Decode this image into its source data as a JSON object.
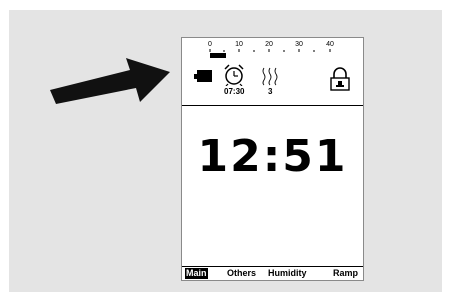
{
  "scale": {
    "labels": [
      "0",
      "10",
      "20",
      "30",
      "40"
    ],
    "level_fraction": 0.13
  },
  "status": {
    "alarm_time": "07:30",
    "humidity_level": "3"
  },
  "clock": {
    "time": "12:51"
  },
  "menu": {
    "items": [
      {
        "label": "Main",
        "active": true
      },
      {
        "label": "Others",
        "active": false
      },
      {
        "label": "Humidity",
        "active": false
      },
      {
        "label": "Ramp",
        "active": false
      }
    ]
  },
  "colors": {
    "background_panel": "#e4e4e4",
    "screen": "#ffffff",
    "ink": "#000000"
  }
}
